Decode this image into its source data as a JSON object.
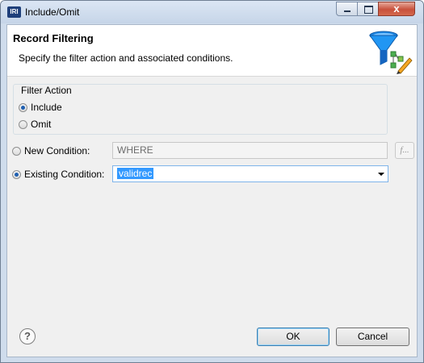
{
  "window": {
    "title": "Include/Omit",
    "logo_text": "IRI",
    "close_glyph": "x"
  },
  "banner": {
    "title": "Record Filtering",
    "description": "Specify the filter action and associated conditions.",
    "icon": "funnel-pencil-icon"
  },
  "filter_action": {
    "label": "Filter Action",
    "options": [
      {
        "label": "Include",
        "checked": true
      },
      {
        "label": "Omit",
        "checked": false
      }
    ]
  },
  "new_condition": {
    "label": "New Condition:",
    "value": "WHERE",
    "checked": false,
    "fx_label": "f..."
  },
  "existing_condition": {
    "label": "Existing Condition:",
    "value": "validrec",
    "checked": true
  },
  "buttons": {
    "ok": "OK",
    "cancel": "Cancel",
    "help": "?"
  },
  "colors": {
    "selection": "#3399ff",
    "radio_dot": "#1f5fb0",
    "funnel": "#1e88e5"
  }
}
